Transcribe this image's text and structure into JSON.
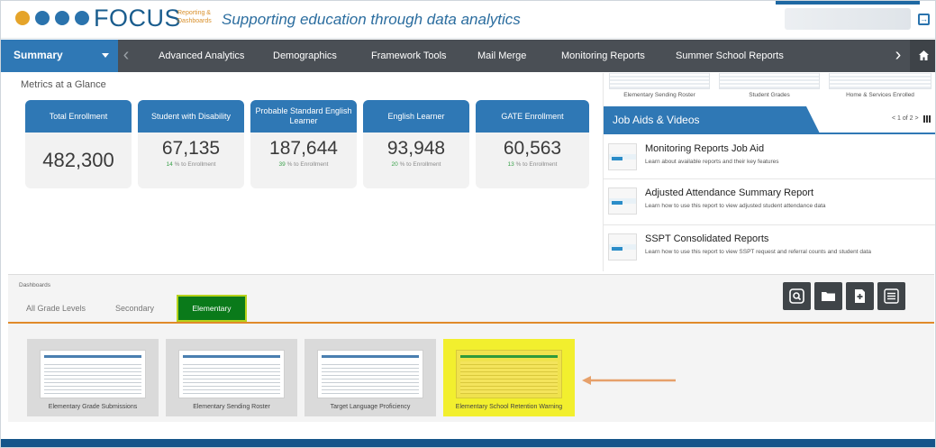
{
  "header": {
    "logo_text": "FOCUS",
    "logo_sub": "Reporting & Dashboards",
    "tagline": "Supporting education through data analytics",
    "brand_colors": [
      "#e5a42a",
      "#2a73ad",
      "#2a73ad",
      "#2a73ad",
      "#e5a42a"
    ]
  },
  "nav": {
    "summary": "Summary",
    "items": [
      "Advanced Analytics",
      "Demographics",
      "Framework Tools",
      "Mail Merge",
      "Monitoring Reports",
      "Summer School Reports"
    ]
  },
  "metrics": {
    "title": "Metrics at a Glance",
    "cards": [
      {
        "label": "Total Enrollment",
        "value": "482,300"
      },
      {
        "label": "Student with Disability",
        "value": "67,135",
        "pct": "14",
        "pct_text": "% to Enrollment"
      },
      {
        "label": "Probable Standard English Learner",
        "value": "187,644",
        "pct": "39",
        "pct_text": "% to Enrollment"
      },
      {
        "label": "English Learner",
        "value": "93,948",
        "pct": "20",
        "pct_text": "% to Enrollment"
      },
      {
        "label": "GATE Enrollment",
        "value": "60,563",
        "pct": "13",
        "pct_text": "% to Enrollment"
      }
    ]
  },
  "right_panel": {
    "reports": [
      "Elementary Sending Roster",
      "Student Grades",
      "Home & Services Enrolled"
    ],
    "job_aids_title": "Job Aids & Videos",
    "pager": "< 1 of 2 >",
    "aids": [
      {
        "title": "Monitoring Reports Job Aid",
        "desc": "Learn about available reports and their key features"
      },
      {
        "title": "Adjusted Attendance Summary Report",
        "desc": "Learn how to use this report to view adjusted student attendance data"
      },
      {
        "title": "SSPT Consolidated Reports",
        "desc": "Learn how to use this report to view SSPT request and referral counts and student data"
      }
    ]
  },
  "dashboards": {
    "label": "Dashboards",
    "tabs": [
      "All Grade Levels",
      "Secondary",
      "Elementary"
    ],
    "tiles": [
      "Elementary Grade Submissions",
      "Elementary Sending Roster",
      "Target Language Proficiency",
      "Elementary School Retention Warning"
    ],
    "highlight_color": "#f2ef2e"
  }
}
